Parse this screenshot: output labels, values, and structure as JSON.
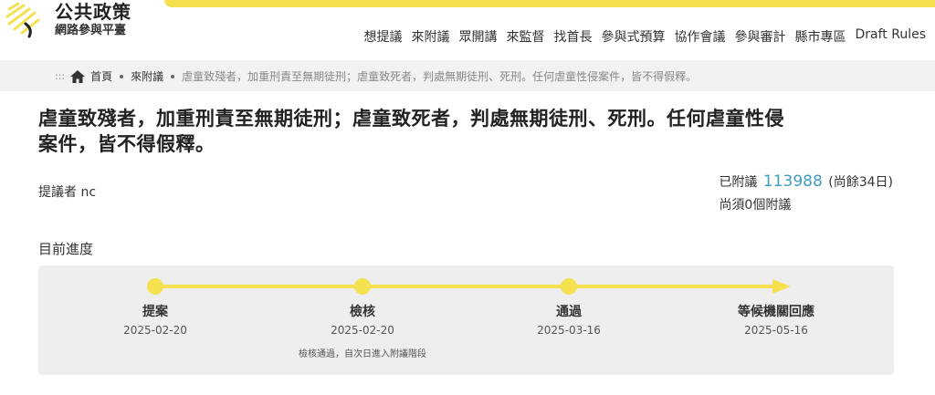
{
  "logo": {
    "title": "公共政策",
    "subtitle": "網路參與平臺"
  },
  "nav": {
    "items": [
      "想提議",
      "來附議",
      "眾開講",
      "來監督",
      "找首長",
      "參與式預算",
      "協作會議",
      "參與審計",
      "縣市專區",
      "Draft Rules"
    ]
  },
  "breadcrumb": {
    "dots": ":::",
    "home": "首頁",
    "section": "來附議",
    "current": "虐童致殘者，加重刑責至無期徒刑；虐童致死者，判處無期徒刑、死刑。任何虐童性侵案件，皆不得假釋。"
  },
  "proposal": {
    "title_line1": "虐童致殘者，加重刑責至無期徒刑；虐童致死者，判處無期徒刑、死刑。任何虐童性侵",
    "title_line2": "案件，皆不得假釋。",
    "proposer_label": "提議者",
    "proposer_name": "nc"
  },
  "stats": {
    "seconded_label": "已附議",
    "seconded_count": "113988",
    "remaining_days": "(尚餘34日)",
    "needed_text": "尚須0個附議"
  },
  "progress": {
    "heading": "目前進度",
    "stages": [
      {
        "label": "提案",
        "date": "2025-02-20",
        "note": ""
      },
      {
        "label": "檢核",
        "date": "2025-02-20",
        "note": "檢核通過，自次日進入附議階段"
      },
      {
        "label": "通過",
        "date": "2025-03-16",
        "note": ""
      },
      {
        "label": "等候機關回應",
        "date": "2025-05-16",
        "note": ""
      }
    ]
  },
  "colors": {
    "accent_yellow": "#f5e150",
    "count_blue": "#3d9dbd",
    "panel_gray": "#eeeeee"
  }
}
